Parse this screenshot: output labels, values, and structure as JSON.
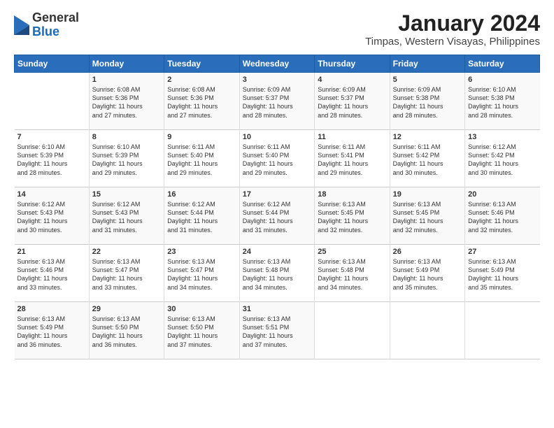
{
  "header": {
    "logo_general": "General",
    "logo_blue": "Blue",
    "title": "January 2024",
    "subtitle": "Timpas, Western Visayas, Philippines"
  },
  "days_of_week": [
    "Sunday",
    "Monday",
    "Tuesday",
    "Wednesday",
    "Thursday",
    "Friday",
    "Saturday"
  ],
  "weeks": [
    [
      {
        "day": "",
        "content": ""
      },
      {
        "day": "1",
        "content": "Sunrise: 6:08 AM\nSunset: 5:36 PM\nDaylight: 11 hours\nand 27 minutes."
      },
      {
        "day": "2",
        "content": "Sunrise: 6:08 AM\nSunset: 5:36 PM\nDaylight: 11 hours\nand 27 minutes."
      },
      {
        "day": "3",
        "content": "Sunrise: 6:09 AM\nSunset: 5:37 PM\nDaylight: 11 hours\nand 28 minutes."
      },
      {
        "day": "4",
        "content": "Sunrise: 6:09 AM\nSunset: 5:37 PM\nDaylight: 11 hours\nand 28 minutes."
      },
      {
        "day": "5",
        "content": "Sunrise: 6:09 AM\nSunset: 5:38 PM\nDaylight: 11 hours\nand 28 minutes."
      },
      {
        "day": "6",
        "content": "Sunrise: 6:10 AM\nSunset: 5:38 PM\nDaylight: 11 hours\nand 28 minutes."
      }
    ],
    [
      {
        "day": "7",
        "content": "Sunrise: 6:10 AM\nSunset: 5:39 PM\nDaylight: 11 hours\nand 28 minutes."
      },
      {
        "day": "8",
        "content": "Sunrise: 6:10 AM\nSunset: 5:39 PM\nDaylight: 11 hours\nand 29 minutes."
      },
      {
        "day": "9",
        "content": "Sunrise: 6:11 AM\nSunset: 5:40 PM\nDaylight: 11 hours\nand 29 minutes."
      },
      {
        "day": "10",
        "content": "Sunrise: 6:11 AM\nSunset: 5:40 PM\nDaylight: 11 hours\nand 29 minutes."
      },
      {
        "day": "11",
        "content": "Sunrise: 6:11 AM\nSunset: 5:41 PM\nDaylight: 11 hours\nand 29 minutes."
      },
      {
        "day": "12",
        "content": "Sunrise: 6:11 AM\nSunset: 5:42 PM\nDaylight: 11 hours\nand 30 minutes."
      },
      {
        "day": "13",
        "content": "Sunrise: 6:12 AM\nSunset: 5:42 PM\nDaylight: 11 hours\nand 30 minutes."
      }
    ],
    [
      {
        "day": "14",
        "content": "Sunrise: 6:12 AM\nSunset: 5:43 PM\nDaylight: 11 hours\nand 30 minutes."
      },
      {
        "day": "15",
        "content": "Sunrise: 6:12 AM\nSunset: 5:43 PM\nDaylight: 11 hours\nand 31 minutes."
      },
      {
        "day": "16",
        "content": "Sunrise: 6:12 AM\nSunset: 5:44 PM\nDaylight: 11 hours\nand 31 minutes."
      },
      {
        "day": "17",
        "content": "Sunrise: 6:12 AM\nSunset: 5:44 PM\nDaylight: 11 hours\nand 31 minutes."
      },
      {
        "day": "18",
        "content": "Sunrise: 6:13 AM\nSunset: 5:45 PM\nDaylight: 11 hours\nand 32 minutes."
      },
      {
        "day": "19",
        "content": "Sunrise: 6:13 AM\nSunset: 5:45 PM\nDaylight: 11 hours\nand 32 minutes."
      },
      {
        "day": "20",
        "content": "Sunrise: 6:13 AM\nSunset: 5:46 PM\nDaylight: 11 hours\nand 32 minutes."
      }
    ],
    [
      {
        "day": "21",
        "content": "Sunrise: 6:13 AM\nSunset: 5:46 PM\nDaylight: 11 hours\nand 33 minutes."
      },
      {
        "day": "22",
        "content": "Sunrise: 6:13 AM\nSunset: 5:47 PM\nDaylight: 11 hours\nand 33 minutes."
      },
      {
        "day": "23",
        "content": "Sunrise: 6:13 AM\nSunset: 5:47 PM\nDaylight: 11 hours\nand 34 minutes."
      },
      {
        "day": "24",
        "content": "Sunrise: 6:13 AM\nSunset: 5:48 PM\nDaylight: 11 hours\nand 34 minutes."
      },
      {
        "day": "25",
        "content": "Sunrise: 6:13 AM\nSunset: 5:48 PM\nDaylight: 11 hours\nand 34 minutes."
      },
      {
        "day": "26",
        "content": "Sunrise: 6:13 AM\nSunset: 5:49 PM\nDaylight: 11 hours\nand 35 minutes."
      },
      {
        "day": "27",
        "content": "Sunrise: 6:13 AM\nSunset: 5:49 PM\nDaylight: 11 hours\nand 35 minutes."
      }
    ],
    [
      {
        "day": "28",
        "content": "Sunrise: 6:13 AM\nSunset: 5:49 PM\nDaylight: 11 hours\nand 36 minutes."
      },
      {
        "day": "29",
        "content": "Sunrise: 6:13 AM\nSunset: 5:50 PM\nDaylight: 11 hours\nand 36 minutes."
      },
      {
        "day": "30",
        "content": "Sunrise: 6:13 AM\nSunset: 5:50 PM\nDaylight: 11 hours\nand 37 minutes."
      },
      {
        "day": "31",
        "content": "Sunrise: 6:13 AM\nSunset: 5:51 PM\nDaylight: 11 hours\nand 37 minutes."
      },
      {
        "day": "",
        "content": ""
      },
      {
        "day": "",
        "content": ""
      },
      {
        "day": "",
        "content": ""
      }
    ]
  ]
}
